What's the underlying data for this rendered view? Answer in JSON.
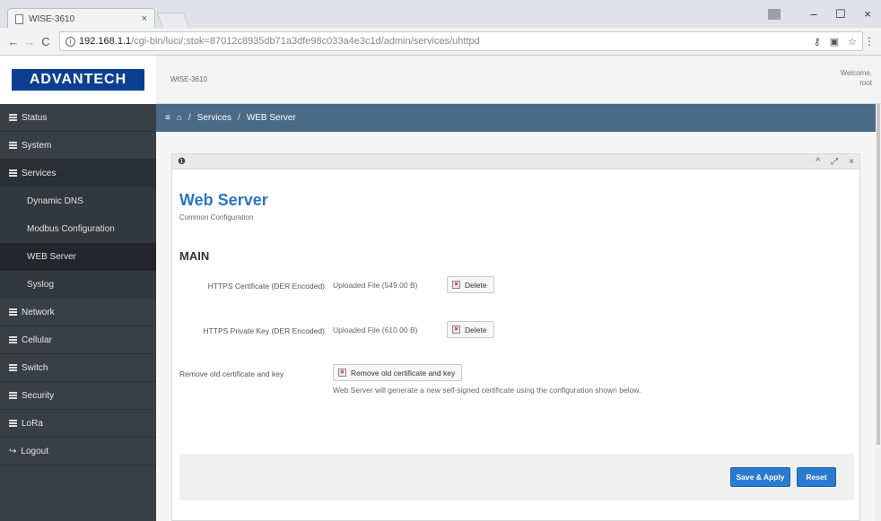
{
  "browser": {
    "tab_title": "WISE-3610",
    "tab_close": "×",
    "url_host": "192.168.1.1",
    "url_path": "/cgi-bin/luci/;stok=87012c8935db71a3dfe98c033a4e3c1d/admin/services/uhttpd",
    "win_minimize": "–",
    "win_maximize": "☐",
    "win_close": "×"
  },
  "header": {
    "logo": "ADVANTECH",
    "device": "WISE-3610",
    "welcome": "Welcome,",
    "user": "root"
  },
  "sidebar": {
    "items": [
      {
        "label": "Status"
      },
      {
        "label": "System"
      },
      {
        "label": "Services"
      }
    ],
    "services_sub": [
      {
        "label": "Dynamic DNS"
      },
      {
        "label": "Modbus Configuration"
      },
      {
        "label": "WEB Server"
      },
      {
        "label": "Syslog"
      }
    ],
    "items2": [
      {
        "label": "Network"
      },
      {
        "label": "Cellular"
      },
      {
        "label": "Switch"
      },
      {
        "label": "Security"
      },
      {
        "label": "LoRa"
      }
    ],
    "logout": "Logout"
  },
  "breadcrumb": {
    "menu": "≡",
    "home": "⌂",
    "sep": "/",
    "services": "Services",
    "current": "WEB Server"
  },
  "panel": {
    "info": "❶",
    "title": "Web Server",
    "subtitle": "Common Configuration",
    "section": "MAIN",
    "cert_label": "HTTPS Certificate (DER Encoded)",
    "cert_value": "Uploaded File (549.00 B)",
    "key_label": "HTTPS Private Key (DER Encoded)",
    "key_value": "Uploaded File (610.00 B)",
    "delete": "Delete",
    "remove_label": "Remove old certificate and key",
    "remove_button": "Remove old certificate and key",
    "remove_help": "Web Server will generate a new self-signed certificate using the configuration shown below.",
    "save_apply": "Save & Apply",
    "reset": "Reset"
  }
}
